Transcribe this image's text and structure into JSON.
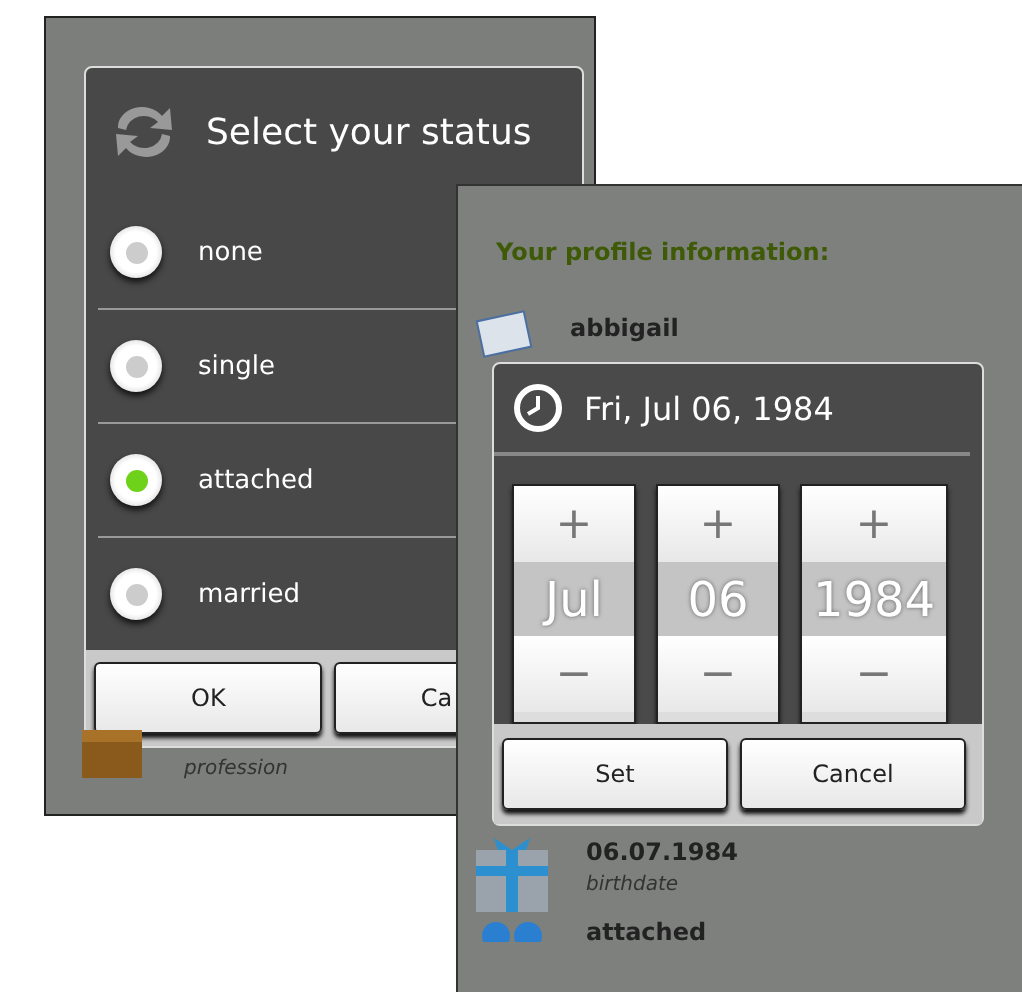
{
  "status_screen": {
    "dialog": {
      "title": "Select your status",
      "options": [
        {
          "label": "none",
          "selected": false
        },
        {
          "label": "single",
          "selected": false
        },
        {
          "label": "attached",
          "selected": true
        },
        {
          "label": "married",
          "selected": false
        }
      ],
      "buttons": [
        "OK",
        "Ca"
      ]
    },
    "profile_items": [
      {
        "caption": "profession"
      }
    ]
  },
  "date_screen": {
    "heading": "Your profile information:",
    "profile_items": [
      {
        "kind": "name",
        "value": "abbigail"
      },
      {
        "kind": "birthdate",
        "value": "06.07.1984",
        "caption": "birthdate"
      },
      {
        "kind": "status",
        "value": "attached"
      }
    ],
    "dialog": {
      "title": "Fri, Jul 06, 1984",
      "spinners": [
        {
          "plus": "+",
          "value": "Jul",
          "minus": "−"
        },
        {
          "plus": "+",
          "value": "06",
          "minus": "−"
        },
        {
          "plus": "+",
          "value": "1984",
          "minus": "−"
        }
      ],
      "buttons": [
        "Set",
        "Cancel"
      ]
    }
  }
}
